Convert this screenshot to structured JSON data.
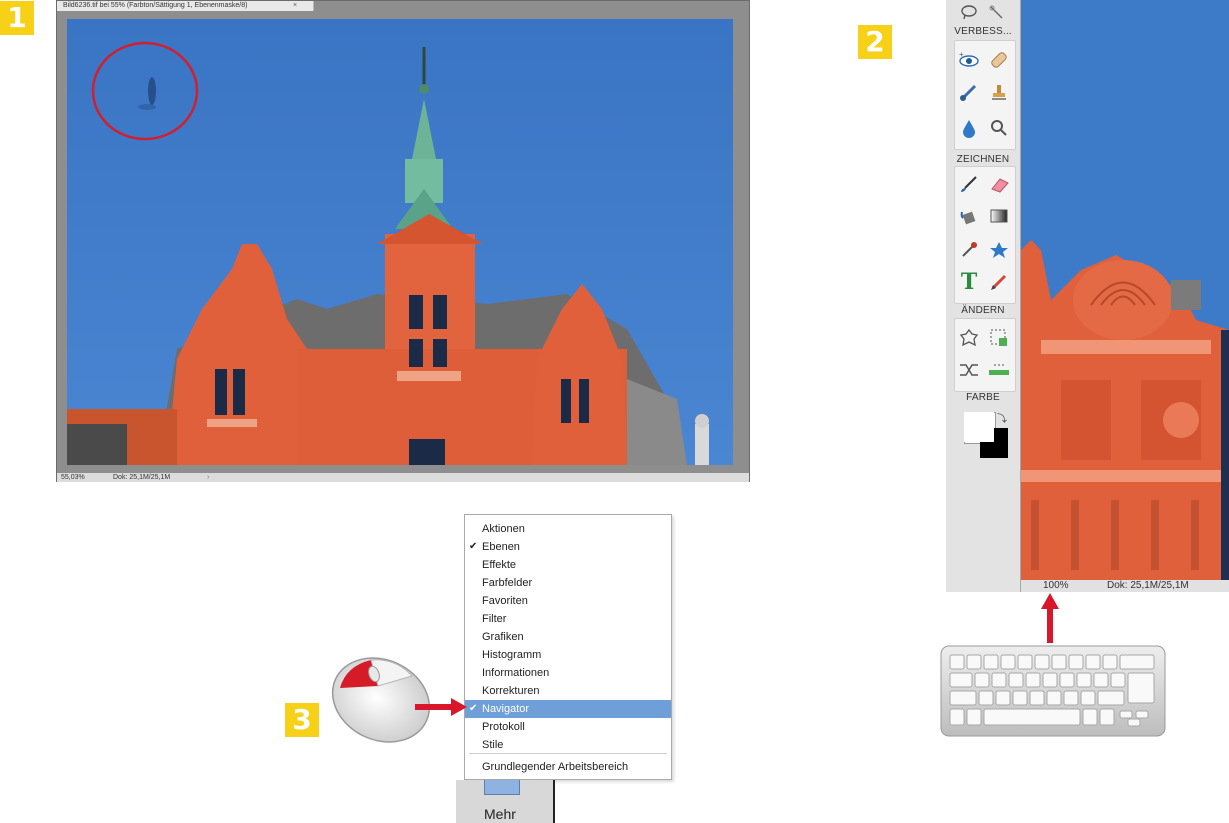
{
  "steps": {
    "one": "1",
    "two": "2",
    "three": "3"
  },
  "window1": {
    "title": "Bild6236.tif bei 55% (Farbton/Sättigung 1, Ebenenmaske/8)",
    "close_symbol": "×",
    "zoom": "55,03%",
    "doc_info": "Dok: 25,1M/25,1M"
  },
  "window2": {
    "sections": {
      "verbess": "VERBESS...",
      "zeichnen": "ZEICHNEN",
      "andern": "ÄNDERN",
      "farbe": "FARBE"
    },
    "text_tool_glyph": "T",
    "zoom": "100%",
    "doc_info": "Dok: 25,1M/25,1M"
  },
  "menu": {
    "items": [
      {
        "label": "Aktionen",
        "checked": false,
        "selected": false
      },
      {
        "label": "Ebenen",
        "checked": true,
        "selected": false
      },
      {
        "label": "Effekte",
        "checked": false,
        "selected": false
      },
      {
        "label": "Farbfelder",
        "checked": false,
        "selected": false
      },
      {
        "label": "Favoriten",
        "checked": false,
        "selected": false
      },
      {
        "label": "Filter",
        "checked": false,
        "selected": false
      },
      {
        "label": "Grafiken",
        "checked": false,
        "selected": false
      },
      {
        "label": "Histogramm",
        "checked": false,
        "selected": false
      },
      {
        "label": "Informationen",
        "checked": false,
        "selected": false
      },
      {
        "label": "Korrekturen",
        "checked": false,
        "selected": false
      },
      {
        "label": "Navigator",
        "checked": true,
        "selected": true
      },
      {
        "label": "Protokoll",
        "checked": false,
        "selected": false
      },
      {
        "label": "Stile",
        "checked": false,
        "selected": false
      }
    ],
    "workspace": "Grundlegender Arbeitsbereich",
    "check_glyph": "✔"
  },
  "mehr_panel": {
    "label": "Mehr"
  },
  "icons": {
    "mouse": "mouse-icon",
    "keyboard": "keyboard-icon",
    "arrow_right": "arrow-right-icon",
    "arrow_up": "arrow-up-icon",
    "highlight_circle": "highlight-circle-icon"
  },
  "colors": {
    "badge": "#f7d117",
    "sky": "#3c78c7",
    "facade": "#e0603c",
    "selection": "#6f9fd8",
    "arrow": "#d9172a",
    "circle": "#d21f2d"
  }
}
